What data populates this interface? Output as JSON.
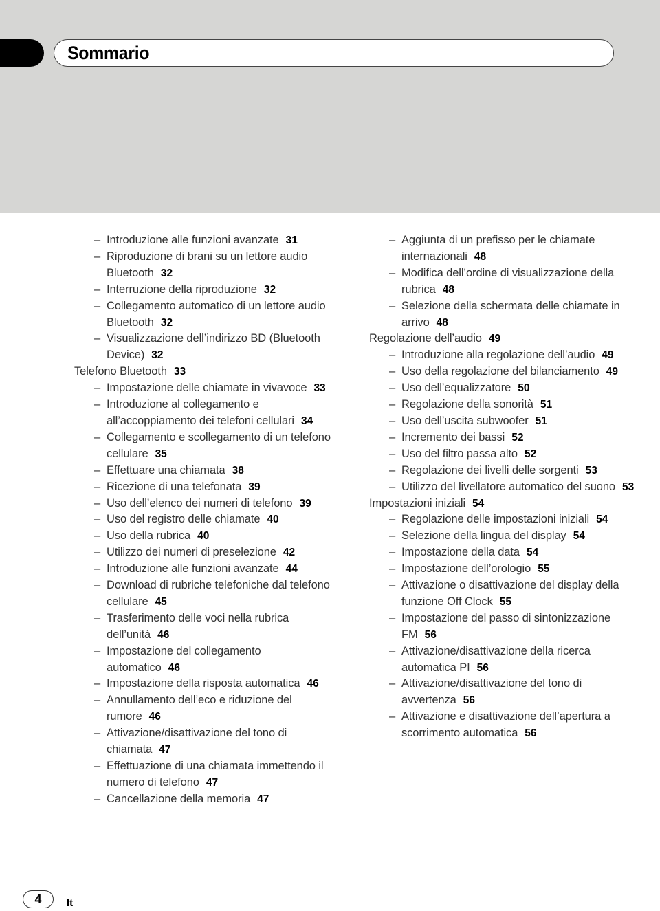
{
  "header": {
    "title": "Sommario"
  },
  "left_column": [
    {
      "level": 2,
      "text": "Introduzione alle funzioni avanzate",
      "page": "31"
    },
    {
      "level": 2,
      "text": "Riproduzione di brani su un lettore audio Bluetooth",
      "page": "32"
    },
    {
      "level": 2,
      "text": "Interruzione della riproduzione",
      "page": "32"
    },
    {
      "level": 2,
      "text": "Collegamento automatico di un lettore audio Bluetooth",
      "page": "32"
    },
    {
      "level": 2,
      "text": "Visualizzazione dell’indirizzo BD (Bluetooth Device)",
      "page": "32"
    },
    {
      "level": 1,
      "text": "Telefono Bluetooth",
      "page": "33"
    },
    {
      "level": 2,
      "text": "Impostazione delle chiamate in vivavoce",
      "page": "33"
    },
    {
      "level": 2,
      "text": "Introduzione al collegamento e all’accoppiamento dei telefoni cellulari",
      "page": "34"
    },
    {
      "level": 2,
      "text": "Collegamento e scollegamento di un telefono cellulare",
      "page": "35"
    },
    {
      "level": 2,
      "text": "Effettuare una chiamata",
      "page": "38"
    },
    {
      "level": 2,
      "text": "Ricezione di una telefonata",
      "page": "39"
    },
    {
      "level": 2,
      "text": "Uso dell’elenco dei numeri di telefono",
      "page": "39"
    },
    {
      "level": 2,
      "text": "Uso del registro delle chiamate",
      "page": "40"
    },
    {
      "level": 2,
      "text": "Uso della rubrica",
      "page": "40"
    },
    {
      "level": 2,
      "text": "Utilizzo dei numeri di preselezione",
      "page": "42"
    },
    {
      "level": 2,
      "text": "Introduzione alle funzioni avanzate",
      "page": "44"
    },
    {
      "level": 2,
      "text": "Download di rubriche telefoniche dal telefono cellulare",
      "page": "45"
    },
    {
      "level": 2,
      "text": "Trasferimento delle voci nella rubrica dell’unità",
      "page": "46"
    },
    {
      "level": 2,
      "text": "Impostazione del collegamento automatico",
      "page": "46"
    },
    {
      "level": 2,
      "text": "Impostazione della risposta automatica",
      "page": "46"
    },
    {
      "level": 2,
      "text": "Annullamento dell’eco e riduzione del rumore",
      "page": "46"
    },
    {
      "level": 2,
      "text": "Attivazione/disattivazione del tono di chiamata",
      "page": "47"
    },
    {
      "level": 2,
      "text": "Effettuazione di una chiamata immettendo il numero di telefono",
      "page": "47"
    },
    {
      "level": 2,
      "text": "Cancellazione della memoria",
      "page": "47"
    }
  ],
  "right_column": [
    {
      "level": 2,
      "text": "Aggiunta di un prefisso per le chiamate internazionali",
      "page": "48"
    },
    {
      "level": 2,
      "text": "Modifica dell’ordine di visualizzazione della rubrica",
      "page": "48"
    },
    {
      "level": 2,
      "text": "Selezione della schermata delle chiamate in arrivo",
      "page": "48"
    },
    {
      "level": 1,
      "text": "Regolazione dell’audio",
      "page": "49"
    },
    {
      "level": 2,
      "text": "Introduzione alla regolazione dell’audio",
      "page": "49"
    },
    {
      "level": 2,
      "text": "Uso della regolazione del bilanciamento",
      "page": "49"
    },
    {
      "level": 2,
      "text": "Uso dell’equalizzatore",
      "page": "50"
    },
    {
      "level": 2,
      "text": "Regolazione della sonorità",
      "page": "51"
    },
    {
      "level": 2,
      "text": "Uso dell’uscita subwoofer",
      "page": "51"
    },
    {
      "level": 2,
      "text": "Incremento dei bassi",
      "page": "52"
    },
    {
      "level": 2,
      "text": "Uso del filtro passa alto",
      "page": "52"
    },
    {
      "level": 2,
      "text": "Regolazione dei livelli delle sorgenti",
      "page": "53"
    },
    {
      "level": 2,
      "text": "Utilizzo del livellatore automatico del suono",
      "page": "53"
    },
    {
      "level": 1,
      "text": "Impostazioni iniziali",
      "page": "54"
    },
    {
      "level": 2,
      "text": "Regolazione delle impostazioni iniziali",
      "page": "54"
    },
    {
      "level": 2,
      "text": "Selezione della lingua del display",
      "page": "54"
    },
    {
      "level": 2,
      "text": "Impostazione della data",
      "page": "54"
    },
    {
      "level": 2,
      "text": "Impostazione dell’orologio",
      "page": "55"
    },
    {
      "level": 2,
      "text": "Attivazione o disattivazione del display della funzione Off Clock",
      "page": "55"
    },
    {
      "level": 2,
      "text": "Impostazione del passo di sintonizzazione FM",
      "page": "56"
    },
    {
      "level": 2,
      "text": "Attivazione/disattivazione della ricerca automatica PI",
      "page": "56"
    },
    {
      "level": 2,
      "text": "Attivazione/disattivazione del tono di avvertenza",
      "page": "56"
    },
    {
      "level": 2,
      "text": "Attivazione e disattivazione dell’apertura a scorrimento automatica",
      "page": "56"
    }
  ],
  "dash_glyph": "–",
  "footer": {
    "page_number": "4",
    "language": "It"
  }
}
